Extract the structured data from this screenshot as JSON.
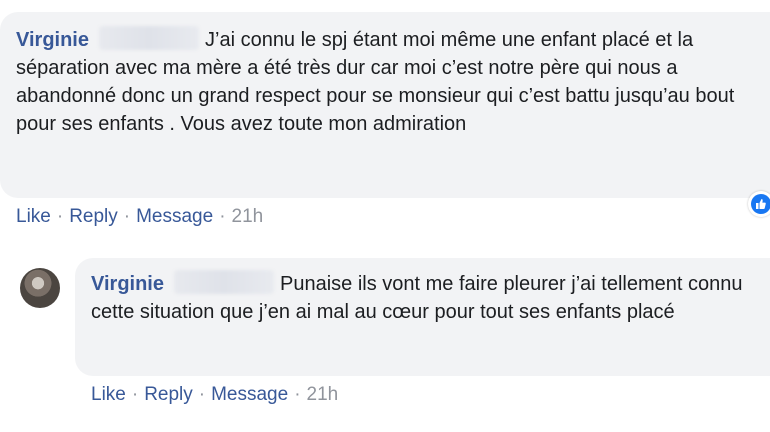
{
  "comments": [
    {
      "author": "Virginie",
      "text": "J’ai connu le spj étant moi même une enfant placé et la séparation avec ma mère a été très dur car moi c’est notre père qui nous a abandonné donc un grand respect pour se monsieur qui c’est battu jusqu’au bout pour ses enfants . Vous avez toute mon admiration",
      "actions": {
        "like": "Like",
        "reply": "Reply",
        "message": "Message",
        "time": "21h"
      },
      "reaction_icon": "like-reaction-icon"
    },
    {
      "author": "Virginie",
      "text": "Punaise ils vont me faire pleurer j’ai tellement connu cette situation que j’en ai mal au cœur pour tout ses enfants placé",
      "actions": {
        "like": "Like",
        "reply": "Reply",
        "message": "Message",
        "time": "21h"
      },
      "avatar_icon": "user-avatar"
    }
  ],
  "separator": "·",
  "colors": {
    "author": "#385898",
    "bubble": "#f2f3f5",
    "meta": "#90949c",
    "like_blue": "#1877f2"
  }
}
